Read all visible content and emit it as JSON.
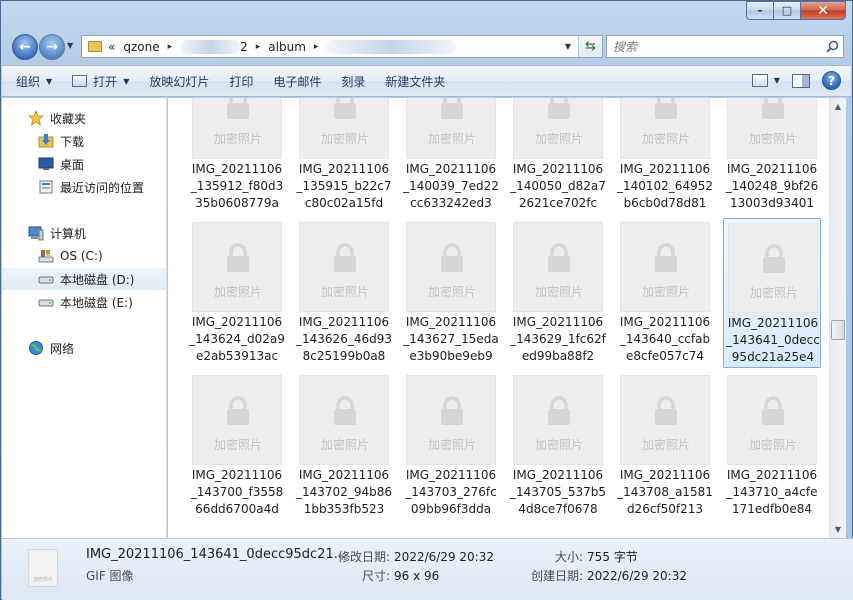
{
  "window": {
    "caption": {
      "minimize": "–",
      "maximize": "□",
      "close": "✕"
    }
  },
  "nav": {
    "back_glyph": "←",
    "forward_glyph": "→",
    "address": {
      "prefix": "«",
      "segments": [
        "qzone",
        "2",
        "album"
      ],
      "separator": "▸"
    },
    "search_placeholder": "搜索"
  },
  "toolbar": {
    "organize": "组织",
    "open": "打开",
    "slideshow": "放映幻灯片",
    "print": "打印",
    "email": "电子邮件",
    "burn": "刻录",
    "new_folder": "新建文件夹",
    "help": "?"
  },
  "sidebar": {
    "favorites": {
      "label": "收藏夹",
      "items": [
        {
          "label": "下载",
          "icon": "download-folder-icon"
        },
        {
          "label": "桌面",
          "icon": "desktop-icon"
        },
        {
          "label": "最近访问的位置",
          "icon": "recent-places-icon"
        }
      ]
    },
    "computer": {
      "label": "计算机",
      "items": [
        {
          "label": "OS (C:)",
          "icon": "system-drive-icon"
        },
        {
          "label": "本地磁盘 (D:)",
          "icon": "drive-icon"
        },
        {
          "label": "本地磁盘 (E:)",
          "icon": "drive-icon"
        }
      ]
    },
    "network": {
      "label": "网络"
    }
  },
  "files": {
    "placeholder_text": "加密照片",
    "rows": [
      [
        "IMG_20211106_135912_f80d335b0608779a",
        "IMG_20211106_135915_b22c7c80c02a15fd",
        "IMG_20211106_140039_7ed22cc633242ed3",
        "IMG_20211106_140050_d82a72621ce702fc",
        "IMG_20211106_140102_64952b6cb0d78d81",
        "IMG_20211106_140248_9bf2613003d93401"
      ],
      [
        "IMG_20211106_143624_d02a9e2ab53913ac",
        "IMG_20211106_143626_46d938c25199b0a8",
        "IMG_20211106_143627_15edae3b90be9eb9",
        "IMG_20211106_143629_1fc62fed99ba88f2",
        "IMG_20211106_143640_ccfabe8cfe057c74",
        "IMG_20211106_143641_0decc95dc21a25e4"
      ],
      [
        "IMG_20211106_143700_f355866dd6700a4d",
        "IMG_20211106_143702_94b861bb353fb523",
        "IMG_20211106_143703_276fc09bb96f3dda",
        "IMG_20211106_143705_537b54d8ce7f0678",
        "IMG_20211106_143708_a1581d26cf50f213",
        "IMG_20211106_143710_a4cfe171edfb0e84"
      ]
    ],
    "selected": {
      "row": 1,
      "col": 5
    }
  },
  "details": {
    "name": "IMG_20211106_143641_0decc95dc21...",
    "type": "GIF 图像",
    "thumb_text": "加密照片",
    "modified_label": "修改日期:",
    "modified_value": "2022/6/29 20:32",
    "dimensions_label": "尺寸:",
    "dimensions_value": "96 x 96",
    "size_label": "大小:",
    "size_value": "755 字节",
    "created_label": "创建日期:",
    "created_value": "2022/6/29 20:32"
  },
  "colors": {
    "selection_border": "#84acdd",
    "placeholder_bg": "#eeeeee",
    "lock_gray": "#d6d6d6"
  }
}
